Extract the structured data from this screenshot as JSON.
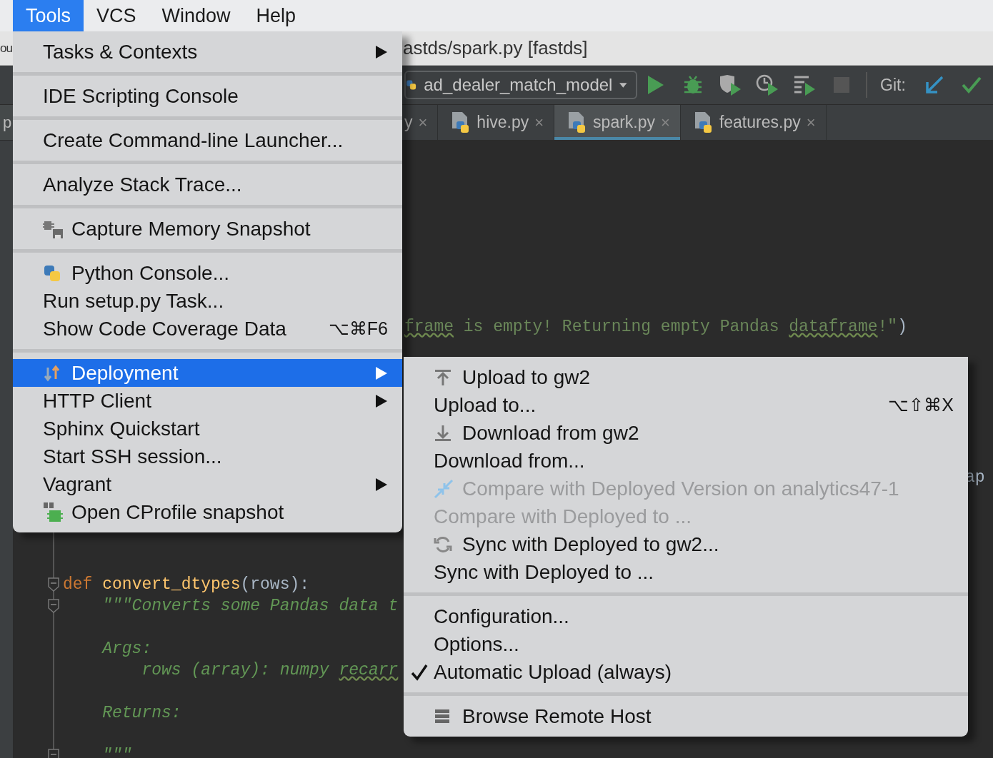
{
  "menu_bar": {
    "items": [
      {
        "label": "Tools",
        "selected": true
      },
      {
        "label": "VCS",
        "selected": false
      },
      {
        "label": "Window",
        "selected": false
      },
      {
        "label": "Help",
        "selected": false
      }
    ]
  },
  "title_bar": {
    "left_fragment": "ou",
    "title": "astds/spark.py [fastds]"
  },
  "toolbar": {
    "run_config": "ad_dealer_match_model",
    "git_label": "Git:"
  },
  "tabs": {
    "left_fragment": "p",
    "items": [
      {
        "kind": "cut",
        "label": "y",
        "close": "×",
        "selected": false
      },
      {
        "kind": "file",
        "label": "hive.py",
        "close": "×",
        "selected": false
      },
      {
        "kind": "file",
        "label": "spark.py",
        "close": "×",
        "selected": true
      },
      {
        "kind": "file",
        "label": "features.py",
        "close": "×",
        "selected": false
      }
    ]
  },
  "editor": {
    "blocks": [
      {
        "lines": [
          {
            "kind": "code",
            "segments": [
              {
                "kind": "string",
                "text": "frame",
                "typo": true
              },
              {
                "kind": "string",
                "text": " is empty! Returning empty Pandas ",
                "typo": false
              },
              {
                "kind": "string",
                "text": "dataframe",
                "typo": true
              },
              {
                "kind": "string",
                "text": "!\"",
                "typo": false
              },
              {
                "kind": "plain",
                "text": ")",
                "typo": false
              }
            ]
          }
        ]
      },
      {
        "lines": [
          {
            "kind": "code",
            "segments": [
              {
                "kind": "plain",
                "text": "ap",
                "typo": false
              }
            ]
          }
        ]
      },
      {
        "lines": [
          {
            "kind": "code",
            "fold": true,
            "segments": [
              {
                "kind": "keyword",
                "text": "def ",
                "typo": false
              },
              {
                "kind": "function",
                "text": "convert_dtypes",
                "typo": false
              },
              {
                "kind": "plain",
                "text": "(rows):",
                "typo": false
              }
            ]
          },
          {
            "kind": "code",
            "fold": true,
            "segments": [
              {
                "kind": "docstring",
                "text": "    \"\"\"Converts some Pandas data t",
                "typo": false
              }
            ]
          },
          {
            "kind": "blank",
            "fold": false
          },
          {
            "kind": "code",
            "fold": false,
            "segments": [
              {
                "kind": "docstring",
                "text": "    Args:",
                "typo": false
              }
            ]
          },
          {
            "kind": "code",
            "fold": false,
            "segments": [
              {
                "kind": "docstring",
                "text": "        rows (array): numpy ",
                "typo": false
              },
              {
                "kind": "docstring",
                "text": "recarr",
                "typo": true
              }
            ]
          },
          {
            "kind": "blank",
            "fold": false
          },
          {
            "kind": "code",
            "fold": false,
            "segments": [
              {
                "kind": "docstring",
                "text": "    Returns:",
                "typo": false
              }
            ]
          },
          {
            "kind": "blank",
            "fold": false
          },
          {
            "kind": "code",
            "fold": true,
            "segments": [
              {
                "kind": "docstring",
                "text": "    \"\"\""
              }
            ]
          }
        ]
      }
    ]
  },
  "tools_menu": {
    "groups": [
      [
        {
          "kind": "plain",
          "label": "Tasks & Contexts",
          "submenu": true,
          "selected": false
        }
      ],
      [
        {
          "kind": "plain",
          "label": "IDE Scripting Console",
          "submenu": false,
          "selected": false
        }
      ],
      [
        {
          "kind": "plain",
          "label": "Create Command-line Launcher...",
          "submenu": false,
          "selected": false
        }
      ],
      [
        {
          "kind": "plain",
          "label": "Analyze Stack Trace...",
          "submenu": false,
          "selected": false
        }
      ],
      [
        {
          "kind": "memory",
          "label": "Capture Memory Snapshot",
          "submenu": false,
          "selected": false
        }
      ],
      [
        {
          "kind": "python",
          "label": "Python Console...",
          "submenu": false,
          "selected": false
        },
        {
          "kind": "plain",
          "label": "Run setup.py Task...",
          "submenu": false,
          "selected": false
        },
        {
          "kind": "plain",
          "label": "Show Code Coverage Data",
          "shortcut": "⌥⌘F6",
          "submenu": false,
          "selected": false
        }
      ],
      [
        {
          "kind": "deploy",
          "label": "Deployment",
          "submenu": true,
          "selected": true
        },
        {
          "kind": "plain",
          "label": "HTTP Client",
          "submenu": true,
          "selected": false
        },
        {
          "kind": "plain",
          "label": "Sphinx Quickstart",
          "submenu": false,
          "selected": false
        },
        {
          "kind": "plain",
          "label": "Start SSH session...",
          "submenu": false,
          "selected": false
        },
        {
          "kind": "plain",
          "label": "Vagrant",
          "submenu": true,
          "selected": false
        },
        {
          "kind": "cprofile",
          "label": "Open CProfile snapshot",
          "submenu": false,
          "selected": false
        }
      ]
    ]
  },
  "deployment_submenu": {
    "groups": [
      [
        {
          "kind": "upload",
          "label": "Upload to gw2",
          "disabled": false,
          "checked": false,
          "selected": false
        },
        {
          "kind": "plain",
          "label": "Upload to...",
          "shortcut": "⌥⇧⌘X",
          "disabled": false,
          "checked": false,
          "selected": false
        },
        {
          "kind": "download",
          "label": "Download from gw2",
          "disabled": false,
          "checked": false,
          "selected": false
        },
        {
          "kind": "plain",
          "label": "Download from...",
          "disabled": false,
          "checked": false,
          "selected": false
        },
        {
          "kind": "compare",
          "label": "Compare with Deployed Version on analytics47-1",
          "disabled": true,
          "checked": false,
          "selected": false
        },
        {
          "kind": "plain",
          "label": "Compare with Deployed to ...",
          "disabled": true,
          "checked": false,
          "selected": false
        },
        {
          "kind": "sync",
          "label": "Sync with Deployed to gw2...",
          "disabled": false,
          "checked": false,
          "selected": false
        },
        {
          "kind": "plain",
          "label": "Sync with Deployed to ...",
          "disabled": false,
          "checked": false,
          "selected": false
        }
      ],
      [
        {
          "kind": "plain",
          "label": "Configuration...",
          "disabled": false,
          "checked": false,
          "selected": false
        },
        {
          "kind": "plain",
          "label": "Options...",
          "disabled": false,
          "checked": false,
          "selected": false
        },
        {
          "kind": "plain",
          "label": "Automatic Upload (always)",
          "disabled": false,
          "checked": true,
          "selected": false
        }
      ],
      [
        {
          "kind": "server",
          "label": "Browse Remote Host",
          "disabled": false,
          "checked": false,
          "selected": false
        }
      ]
    ]
  }
}
